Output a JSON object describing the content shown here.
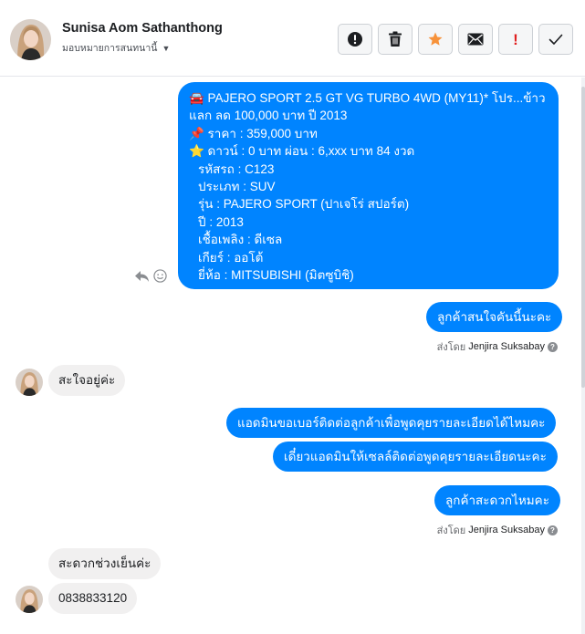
{
  "header": {
    "contact_name": "Sunisa Aom Sathanthong",
    "assign_label": "มอบหมายการสนทนานี้"
  },
  "toolbar": {
    "buttons": [
      {
        "name": "report-button",
        "icon": "alert-circle-icon"
      },
      {
        "name": "delete-button",
        "icon": "trash-icon"
      },
      {
        "name": "star-button",
        "icon": "star-icon"
      },
      {
        "name": "mail-button",
        "icon": "envelope-icon"
      },
      {
        "name": "mark-important-button",
        "icon": "exclamation-icon"
      },
      {
        "name": "mark-done-button",
        "icon": "check-icon"
      }
    ],
    "important_glyph": "!"
  },
  "colors": {
    "outgoing_bubble": "#0084ff",
    "incoming_bubble": "#f1f0f0",
    "star": "#f7923a",
    "important": "#e02020"
  },
  "messages": {
    "car_card": {
      "lines": [
        "🚘 PAJERO SPORT 2.5 GT VG TURBO 4WD (MY11)* โปร...ข้าว",
        "แลก ลด 100,000 บาท ปี 2013",
        "📌 ราคา : 359,000 บาท",
        "⭐ ดาวน์ : 0 บาท ผ่อน : 6,xxx บาท 84 งวด",
        "รหัสรถ : C123",
        "ประเภท : SUV",
        "รุ่น : PAJERO SPORT (ปาเจโร่ สปอร์ต)",
        "ปี : 2013",
        "เชื้อเพลิง : ดีเซล",
        "เกียร์ : ออโต้",
        "ยี่ห้อ : MITSUBISHI (มิตซูบิชิ)"
      ]
    },
    "out_1": "ลูกค้าสนใจคันนี้นะคะ",
    "in_1": "สะใจอยู่ค่ะ",
    "out_2": "แอดมินขอเบอร์ติดต่อลูกค้าเพื่อพูดคุยรายละเอียดได้ไหมคะ",
    "out_3": "เดี๋ยวแอดมินให้เซลล์ติดต่อพูดคุยรายละเอียดนะคะ",
    "out_4": "ลูกค้าสะดวกไหมคะ",
    "in_2": "สะดวกช่วงเย็นค่ะ",
    "in_3": "0838833120"
  },
  "sent_by": {
    "prefix": "ส่งโดย",
    "agent": "Jenjira Suksabay",
    "info": "?"
  }
}
